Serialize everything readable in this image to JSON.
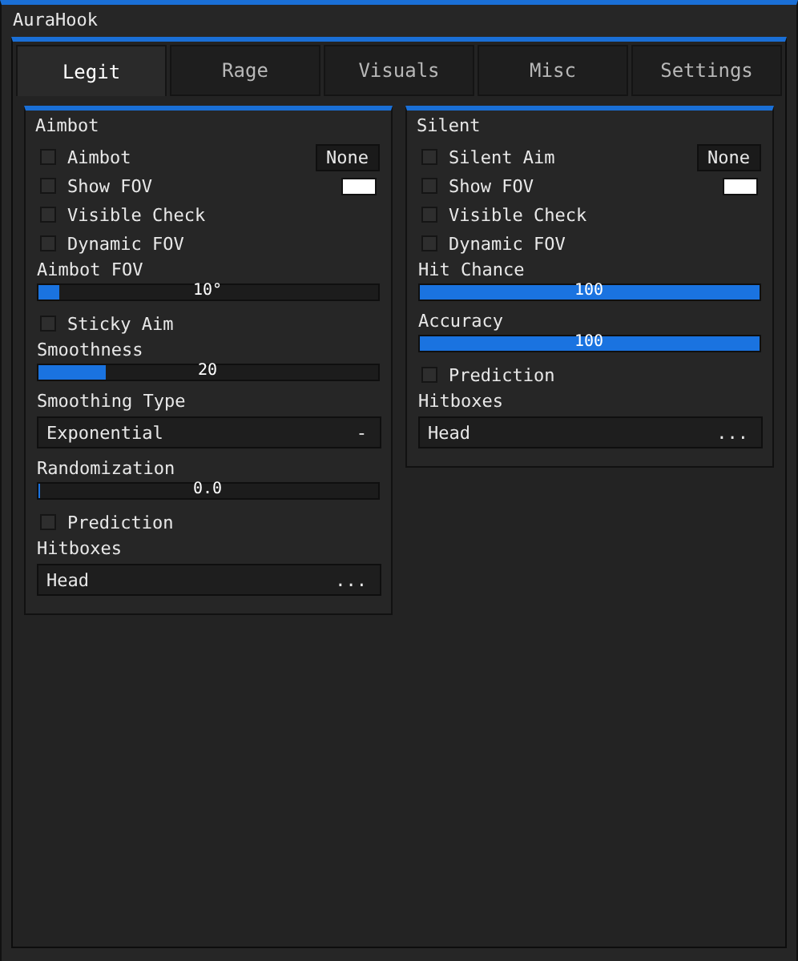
{
  "window": {
    "title": "AuraHook"
  },
  "tabs": [
    {
      "label": "Legit",
      "selected": true
    },
    {
      "label": "Rage",
      "selected": false
    },
    {
      "label": "Visuals",
      "selected": false
    },
    {
      "label": "Misc",
      "selected": false
    },
    {
      "label": "Settings",
      "selected": false
    }
  ],
  "panels": [
    {
      "title": "Aimbot",
      "items": [
        {
          "kind": "checkbox",
          "label": "Aimbot",
          "checked": false,
          "keybind": "None"
        },
        {
          "kind": "checkbox",
          "label": "Show FOV",
          "checked": false,
          "color": "#ffffff"
        },
        {
          "kind": "checkbox",
          "label": "Visible Check",
          "checked": false
        },
        {
          "kind": "checkbox",
          "label": "Dynamic FOV",
          "checked": false
        },
        {
          "kind": "slider",
          "label": "Aimbot FOV",
          "level": 0.06,
          "reading": "10°"
        },
        {
          "kind": "checkbox",
          "label": "Sticky Aim",
          "checked": false
        },
        {
          "kind": "slider",
          "label": "Smoothness",
          "level": 0.2,
          "reading": "20"
        },
        {
          "kind": "dropdown",
          "label": "Smoothing Type",
          "value": "Exponential",
          "arrow": "-"
        },
        {
          "kind": "slider",
          "label": "Randomization",
          "level": 0,
          "reading": "0.0"
        },
        {
          "kind": "checkbox",
          "label": "Prediction",
          "checked": false
        },
        {
          "kind": "dropdown",
          "label": "Hitboxes",
          "value": "Head",
          "arrow": "..."
        }
      ]
    },
    {
      "title": "Silent",
      "items": [
        {
          "kind": "checkbox",
          "label": "Silent Aim",
          "checked": false,
          "keybind": "None"
        },
        {
          "kind": "checkbox",
          "label": "Show FOV",
          "checked": false,
          "color": "#ffffff"
        },
        {
          "kind": "checkbox",
          "label": "Visible Check",
          "checked": false
        },
        {
          "kind": "checkbox",
          "label": "Dynamic FOV",
          "checked": false
        },
        {
          "kind": "slider",
          "label": "Hit Chance",
          "level": 1,
          "reading": "100"
        },
        {
          "kind": "slider",
          "label": "Accuracy",
          "level": 1,
          "reading": "100"
        },
        {
          "kind": "checkbox",
          "label": "Prediction",
          "checked": false
        },
        {
          "kind": "dropdown",
          "label": "Hitboxes",
          "value": "Head",
          "arrow": "..."
        }
      ]
    }
  ]
}
